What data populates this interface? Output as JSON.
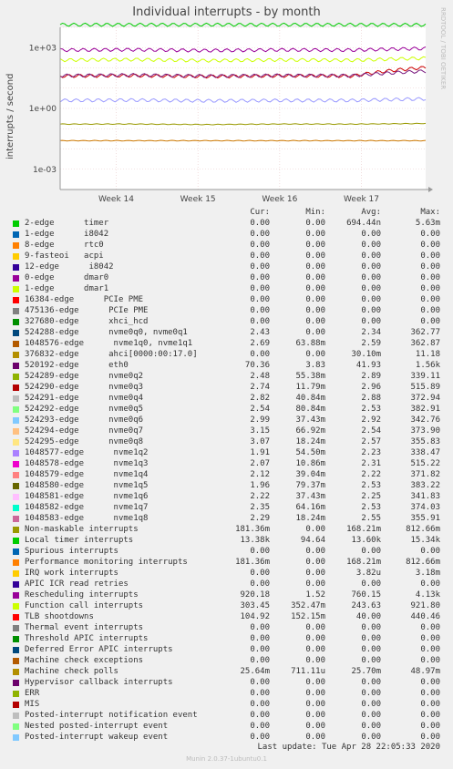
{
  "side_note": "RRDTOOL / TOBI OETIKER",
  "chart_data": {
    "type": "line",
    "title": "Individual interrupts - by month",
    "ylabel": "interrupts / second",
    "yscale": "log",
    "ylim": [
      0.0001,
      10000
    ],
    "yticks": [
      "1e+03",
      "1e+00",
      "1e-03"
    ],
    "x_range_days": [
      0,
      31.3
    ],
    "xticks": [
      {
        "label": "Week 14",
        "day": 4.8
      },
      {
        "label": "Week 15",
        "day": 11.8
      },
      {
        "label": "Week 16",
        "day": 18.8
      },
      {
        "label": "Week 17",
        "day": 25.8
      }
    ],
    "grid": true,
    "series": [
      {
        "name": "Local timer interrupts",
        "color": "#00cc00",
        "values": [
          13600,
          13600,
          13600,
          13600,
          13600,
          13380
        ]
      },
      {
        "name": "Rescheduling interrupts",
        "color": "#990099",
        "values": [
          760,
          800,
          720,
          780,
          760,
          920
        ]
      },
      {
        "name": "Function call interrupts",
        "color": "#ccff00",
        "values": [
          244,
          260,
          230,
          250,
          240,
          303
        ]
      },
      {
        "name": "TLB shootdowns",
        "color": "#cc0000",
        "values": [
          40,
          42,
          38,
          41,
          40,
          105
        ]
      },
      {
        "name": "520192-edge eth0",
        "color": "#7a1c80",
        "values": [
          42,
          45,
          40,
          43,
          42,
          70
        ]
      },
      {
        "name": "nvme queues",
        "color": "#9999ff",
        "values": [
          2.5,
          2.6,
          2.4,
          2.5,
          2.5,
          3.0
        ]
      },
      {
        "name": "Non-maskable interrupts",
        "color": "#999900",
        "values": [
          0.168,
          0.17,
          0.16,
          0.17,
          0.168,
          0.181
        ]
      },
      {
        "name": "Machine check polls",
        "color": "#cc7700",
        "values": [
          0.0257,
          0.0257,
          0.0257,
          0.0257,
          0.0257,
          0.0256
        ]
      }
    ]
  },
  "legend": {
    "headers": {
      "cur": "Cur:",
      "min": "Min:",
      "avg": "Avg:",
      "max": "Max:"
    },
    "rows": [
      {
        "name": "2-edge      timer",
        "color": "#00cc00",
        "cur": "0.00",
        "min": "0.00",
        "avg": "694.44n",
        "max": "5.63m"
      },
      {
        "name": "1-edge      i8042",
        "color": "#0066b3",
        "cur": "0.00",
        "min": "0.00",
        "avg": "0.00",
        "max": "0.00"
      },
      {
        "name": "8-edge      rtc0",
        "color": "#ff8000",
        "cur": "0.00",
        "min": "0.00",
        "avg": "0.00",
        "max": "0.00"
      },
      {
        "name": "9-fasteoi   acpi",
        "color": "#ffcc00",
        "cur": "0.00",
        "min": "0.00",
        "avg": "0.00",
        "max": "0.00"
      },
      {
        "name": "12-edge      i8042",
        "color": "#330099",
        "cur": "0.00",
        "min": "0.00",
        "avg": "0.00",
        "max": "0.00"
      },
      {
        "name": "0-edge      dmar0",
        "color": "#990099",
        "cur": "0.00",
        "min": "0.00",
        "avg": "0.00",
        "max": "0.00"
      },
      {
        "name": "1-edge      dmar1",
        "color": "#ccff00",
        "cur": "0.00",
        "min": "0.00",
        "avg": "0.00",
        "max": "0.00"
      },
      {
        "name": "16384-edge      PCIe PME",
        "color": "#ff0000",
        "cur": "0.00",
        "min": "0.00",
        "avg": "0.00",
        "max": "0.00"
      },
      {
        "name": "475136-edge      PCIe PME",
        "color": "#808080",
        "cur": "0.00",
        "min": "0.00",
        "avg": "0.00",
        "max": "0.00"
      },
      {
        "name": "327680-edge      xhci_hcd",
        "color": "#008f00",
        "cur": "0.00",
        "min": "0.00",
        "avg": "0.00",
        "max": "0.00"
      },
      {
        "name": "524288-edge      nvme0q0, nvme0q1",
        "color": "#00487d",
        "cur": "2.43",
        "min": "0.00",
        "avg": "2.34",
        "max": "362.77"
      },
      {
        "name": "1048576-edge      nvme1q0, nvme1q1",
        "color": "#b35a00",
        "cur": "2.69",
        "min": "63.88m",
        "avg": "2.59",
        "max": "362.87"
      },
      {
        "name": "376832-edge      ahci[0000:00:17.0]",
        "color": "#b38f00",
        "cur": "0.00",
        "min": "0.00",
        "avg": "30.10m",
        "max": "11.18"
      },
      {
        "name": "520192-edge      eth0",
        "color": "#6b006b",
        "cur": "70.36",
        "min": "3.83",
        "avg": "41.93",
        "max": "1.56k"
      },
      {
        "name": "524289-edge      nvme0q2",
        "color": "#8fb300",
        "cur": "2.48",
        "min": "55.38m",
        "avg": "2.89",
        "max": "339.11"
      },
      {
        "name": "524290-edge      nvme0q3",
        "color": "#b30000",
        "cur": "2.74",
        "min": "11.79m",
        "avg": "2.96",
        "max": "515.89"
      },
      {
        "name": "524291-edge      nvme0q4",
        "color": "#bebebe",
        "cur": "2.82",
        "min": "40.84m",
        "avg": "2.88",
        "max": "372.94"
      },
      {
        "name": "524292-edge      nvme0q5",
        "color": "#80ff80",
        "cur": "2.54",
        "min": "80.84m",
        "avg": "2.53",
        "max": "382.91"
      },
      {
        "name": "524293-edge      nvme0q6",
        "color": "#80c9ff",
        "cur": "2.99",
        "min": "37.43m",
        "avg": "2.92",
        "max": "342.76"
      },
      {
        "name": "524294-edge      nvme0q7",
        "color": "#ffc080",
        "cur": "3.15",
        "min": "66.92m",
        "avg": "2.54",
        "max": "373.90"
      },
      {
        "name": "524295-edge      nvme0q8",
        "color": "#ffe680",
        "cur": "3.07",
        "min": "18.24m",
        "avg": "2.57",
        "max": "355.83"
      },
      {
        "name": "1048577-edge      nvme1q2",
        "color": "#aa80ff",
        "cur": "1.91",
        "min": "54.50m",
        "avg": "2.23",
        "max": "338.47"
      },
      {
        "name": "1048578-edge      nvme1q3",
        "color": "#ee00cc",
        "cur": "2.07",
        "min": "10.86m",
        "avg": "2.31",
        "max": "515.22"
      },
      {
        "name": "1048579-edge      nvme1q4",
        "color": "#ff8080",
        "cur": "2.12",
        "min": "39.04m",
        "avg": "2.22",
        "max": "371.82"
      },
      {
        "name": "1048580-edge      nvme1q5",
        "color": "#666600",
        "cur": "1.96",
        "min": "79.37m",
        "avg": "2.53",
        "max": "383.22"
      },
      {
        "name": "1048581-edge      nvme1q6",
        "color": "#ffbfff",
        "cur": "2.22",
        "min": "37.43m",
        "avg": "2.25",
        "max": "341.83"
      },
      {
        "name": "1048582-edge      nvme1q7",
        "color": "#00ffcc",
        "cur": "2.35",
        "min": "64.16m",
        "avg": "2.53",
        "max": "374.03"
      },
      {
        "name": "1048583-edge      nvme1q8",
        "color": "#cc6699",
        "cur": "2.29",
        "min": "18.24m",
        "avg": "2.55",
        "max": "355.91"
      },
      {
        "name": "Non-maskable interrupts",
        "color": "#999900",
        "cur": "181.36m",
        "min": "0.00",
        "avg": "168.21m",
        "max": "812.66m"
      },
      {
        "name": "Local timer interrupts",
        "color": "#00cc00",
        "cur": "13.38k",
        "min": "94.64",
        "avg": "13.60k",
        "max": "15.34k"
      },
      {
        "name": "Spurious interrupts",
        "color": "#0066b3",
        "cur": "0.00",
        "min": "0.00",
        "avg": "0.00",
        "max": "0.00"
      },
      {
        "name": "Performance monitoring interrupts",
        "color": "#ff8000",
        "cur": "181.36m",
        "min": "0.00",
        "avg": "168.21m",
        "max": "812.66m"
      },
      {
        "name": "IRQ work interrupts",
        "color": "#ffcc00",
        "cur": "0.00",
        "min": "0.00",
        "avg": "3.82u",
        "max": "3.18m"
      },
      {
        "name": "APIC ICR read retries",
        "color": "#330099",
        "cur": "0.00",
        "min": "0.00",
        "avg": "0.00",
        "max": "0.00"
      },
      {
        "name": "Rescheduling interrupts",
        "color": "#990099",
        "cur": "920.18",
        "min": "1.52",
        "avg": "760.15",
        "max": "4.13k"
      },
      {
        "name": "Function call interrupts",
        "color": "#ccff00",
        "cur": "303.45",
        "min": "352.47m",
        "avg": "243.63",
        "max": "921.80"
      },
      {
        "name": "TLB shootdowns",
        "color": "#ff0000",
        "cur": "104.92",
        "min": "152.15m",
        "avg": "40.00",
        "max": "440.46"
      },
      {
        "name": "Thermal event interrupts",
        "color": "#808080",
        "cur": "0.00",
        "min": "0.00",
        "avg": "0.00",
        "max": "0.00"
      },
      {
        "name": "Threshold APIC interrupts",
        "color": "#008f00",
        "cur": "0.00",
        "min": "0.00",
        "avg": "0.00",
        "max": "0.00"
      },
      {
        "name": "Deferred Error APIC interrupts",
        "color": "#00487d",
        "cur": "0.00",
        "min": "0.00",
        "avg": "0.00",
        "max": "0.00"
      },
      {
        "name": "Machine check exceptions",
        "color": "#b35a00",
        "cur": "0.00",
        "min": "0.00",
        "avg": "0.00",
        "max": "0.00"
      },
      {
        "name": "Machine check polls",
        "color": "#b38f00",
        "cur": "25.64m",
        "min": "711.11u",
        "avg": "25.70m",
        "max": "48.97m"
      },
      {
        "name": "Hypervisor callback interrupts",
        "color": "#6b006b",
        "cur": "0.00",
        "min": "0.00",
        "avg": "0.00",
        "max": "0.00"
      },
      {
        "name": "ERR",
        "color": "#8fb300",
        "cur": "0.00",
        "min": "0.00",
        "avg": "0.00",
        "max": "0.00"
      },
      {
        "name": "MIS",
        "color": "#b30000",
        "cur": "0.00",
        "min": "0.00",
        "avg": "0.00",
        "max": "0.00"
      },
      {
        "name": "Posted-interrupt notification event",
        "color": "#bebebe",
        "cur": "0.00",
        "min": "0.00",
        "avg": "0.00",
        "max": "0.00"
      },
      {
        "name": "Nested posted-interrupt event",
        "color": "#80ff80",
        "cur": "0.00",
        "min": "0.00",
        "avg": "0.00",
        "max": "0.00"
      },
      {
        "name": "Posted-interrupt wakeup event",
        "color": "#80c9ff",
        "cur": "0.00",
        "min": "0.00",
        "avg": "0.00",
        "max": "0.00"
      }
    ]
  },
  "footer": {
    "last_update": "Last update: Tue Apr 28 22:05:33 2020",
    "version": "Munin 2.0.37-1ubuntu0.1"
  }
}
